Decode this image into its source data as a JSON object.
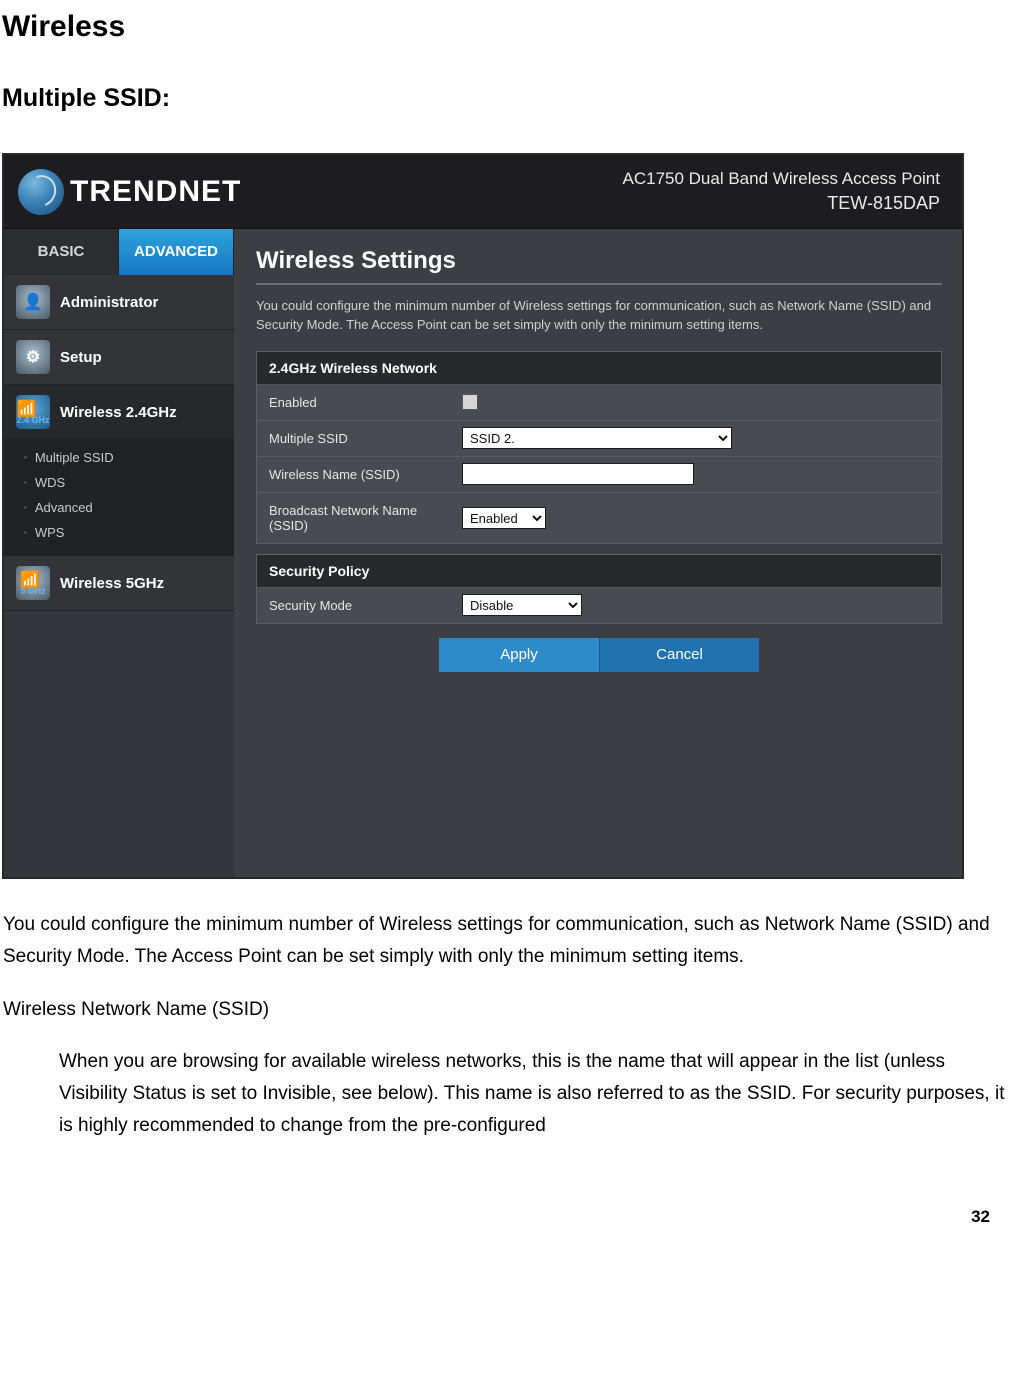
{
  "doc": {
    "heading": "Wireless",
    "subheading": "Multiple SSID:",
    "para1": "You could configure the minimum number of Wireless settings for communication, such as Network Name (SSID) and Security Mode. The Access Point can be set simply with only the minimum setting items.",
    "def_term": "Wireless Network Name (SSID)",
    "def_body": "When you are browsing for available wireless networks, this is the name that will appear in the list (unless Visibility Status is set to Invisible, see below). This name is also referred to as the SSID. For security purposes, it is highly recommended to change from the pre-configured",
    "page_number": "32"
  },
  "brand": {
    "logo_text": "TRENDNET",
    "prod_line1": "AC1750 Dual Band Wireless Access Point",
    "prod_line2": "TEW-815DAP"
  },
  "tabs": {
    "basic": "BASIC",
    "advanced": "ADVANCED"
  },
  "side": {
    "admin": "Administrator",
    "setup": "Setup",
    "w24": "Wireless 2.4GHz",
    "band24": "2.4 GHz",
    "w5": "Wireless 5GHz",
    "band5": "5 GHz",
    "sub": {
      "multiple_ssid": "Multiple SSID",
      "wds": "WDS",
      "advanced": "Advanced",
      "wps": "WPS"
    }
  },
  "content": {
    "title": "Wireless Settings",
    "intro": "You could configure the minimum number of Wireless settings for communication, such as Network Name (SSID) and Security Mode. The Access Point can be set simply with only the minimum setting items.",
    "panel1_title": "2.4GHz Wireless Network",
    "fields": {
      "enabled": "Enabled",
      "multiple_ssid": "Multiple SSID",
      "multiple_ssid_value": "SSID 2.",
      "wireless_name": "Wireless Name (SSID)",
      "wireless_name_value": "",
      "broadcast": "Broadcast Network Name (SSID)",
      "broadcast_value": "Enabled"
    },
    "panel2_title": "Security Policy",
    "sec_mode_label": "Security Mode",
    "sec_mode_value": "Disable",
    "btn_apply": "Apply",
    "btn_cancel": "Cancel"
  }
}
